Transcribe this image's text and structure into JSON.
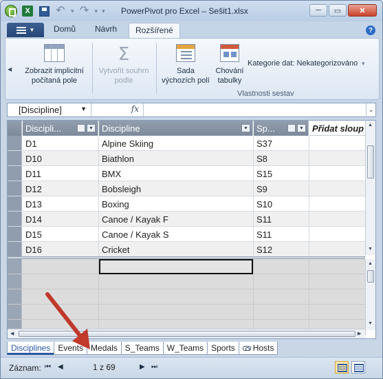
{
  "window": {
    "title": "PowerPivot pro Excel – Sešit1.xlsx",
    "buttons": [
      "─",
      "▭",
      "✕"
    ]
  },
  "ribbon_tabs": {
    "file_icon": "menu-icon",
    "items": [
      {
        "label": "Domů",
        "active": false
      },
      {
        "label": "Návrh",
        "active": false
      },
      {
        "label": "Rozšířené",
        "active": true
      }
    ]
  },
  "ribbon": {
    "btn_implicit": {
      "line1": "Zobrazit implicitní",
      "line2": "počítaná pole"
    },
    "btn_summary": {
      "line1": "Vytvořit souhrn",
      "line2": "podle"
    },
    "btn_sada": {
      "line1": "Sada",
      "line2": "výchozích polí"
    },
    "btn_chovani": {
      "line1": "Chování",
      "line2": "tabulky"
    },
    "kategorie": "Kategorie dat: Nekategorizováno",
    "group_label": "Vlastnosti sestav"
  },
  "formula_bar": {
    "name_box": "[Discipline]",
    "fx": "fx",
    "value": ""
  },
  "table": {
    "headers": [
      "Discipli...",
      "Discipline",
      "Sp...",
      "Přidat sloup"
    ],
    "rows": [
      [
        "D1",
        "Alpine Skiing",
        "S37"
      ],
      [
        "D10",
        "Biathlon",
        "S8"
      ],
      [
        "D11",
        "BMX",
        "S15"
      ],
      [
        "D12",
        "Bobsleigh",
        "S9"
      ],
      [
        "D13",
        "Boxing",
        "S10"
      ],
      [
        "D14",
        "Canoe / Kayak F",
        "S11"
      ],
      [
        "D15",
        "Canoe / Kayak S",
        "S11"
      ],
      [
        "D16",
        "Cricket",
        "S12"
      ]
    ]
  },
  "sheet_tabs": [
    "Disciplines",
    "Events",
    "Medals",
    "S_Teams",
    "W_Teams",
    "Sports",
    "Hosts"
  ],
  "status": {
    "record_label": "Záznam:",
    "counter": "1 z 69"
  },
  "colors": {
    "header_bg": "#8a96a6",
    "accent": "#2b57a0",
    "arrow": "#c0392b"
  }
}
